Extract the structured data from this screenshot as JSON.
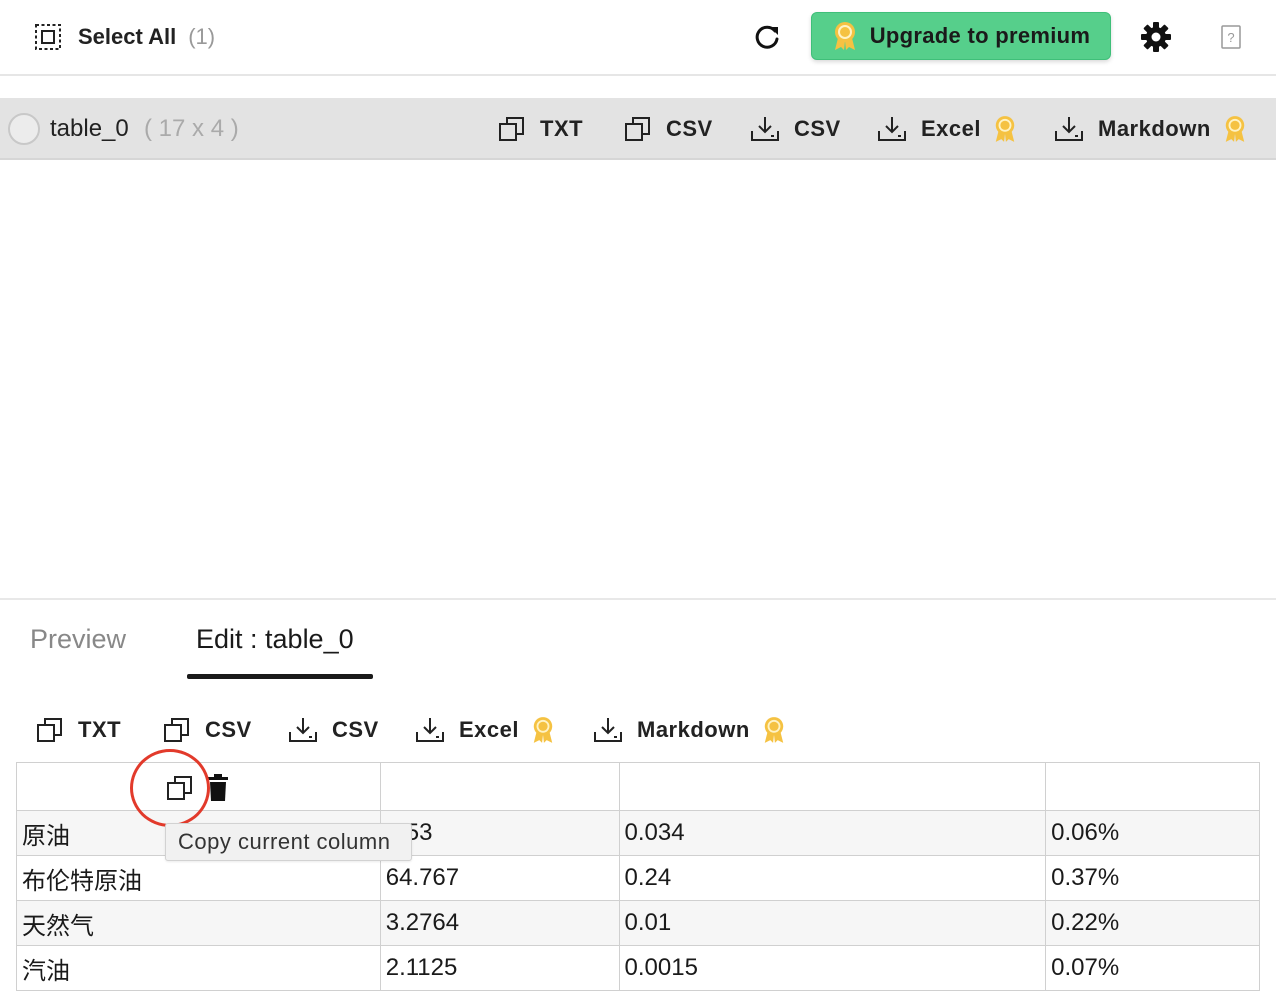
{
  "topbar": {
    "select_all_label": "Select All",
    "select_all_count": "(1)",
    "upgrade_label": "Upgrade to premium",
    "upgrade_color": "#56cf8b"
  },
  "table_item": {
    "name": "table_0",
    "dims": "( 17 x 4 )",
    "actions": [
      {
        "icon": "copy-icon",
        "label": "TXT"
      },
      {
        "icon": "copy-icon",
        "label": "CSV"
      },
      {
        "icon": "download-icon",
        "label": "CSV"
      },
      {
        "icon": "download-icon",
        "label": "Excel",
        "premium": true
      },
      {
        "icon": "download-icon",
        "label": "Markdown",
        "premium": true
      }
    ]
  },
  "tabs": {
    "preview_label": "Preview",
    "edit_label": "Edit : table_0"
  },
  "edit_toolbar": {
    "actions": [
      {
        "icon": "copy-icon",
        "label": "TXT"
      },
      {
        "icon": "copy-icon",
        "label": "CSV"
      },
      {
        "icon": "download-icon",
        "label": "CSV"
      },
      {
        "icon": "download-icon",
        "label": "Excel",
        "premium": true
      },
      {
        "icon": "download-icon",
        "label": "Markdown",
        "premium": true
      }
    ]
  },
  "tooltip": "Copy current column",
  "grid": {
    "rows": [
      [
        "原油",
        ".553",
        "0.034",
        "0.06%"
      ],
      [
        "布伦特原油",
        "64.767",
        "0.24",
        "0.37%"
      ],
      [
        "天然气",
        "3.2764",
        "0.01",
        "0.22%"
      ],
      [
        "汽油",
        "2.1125",
        "0.0015",
        "0.07%"
      ]
    ]
  },
  "colors": {
    "accent_green": "#56cf8b",
    "medal_gold": "#f5c242",
    "highlight_red": "#e23a2b"
  }
}
